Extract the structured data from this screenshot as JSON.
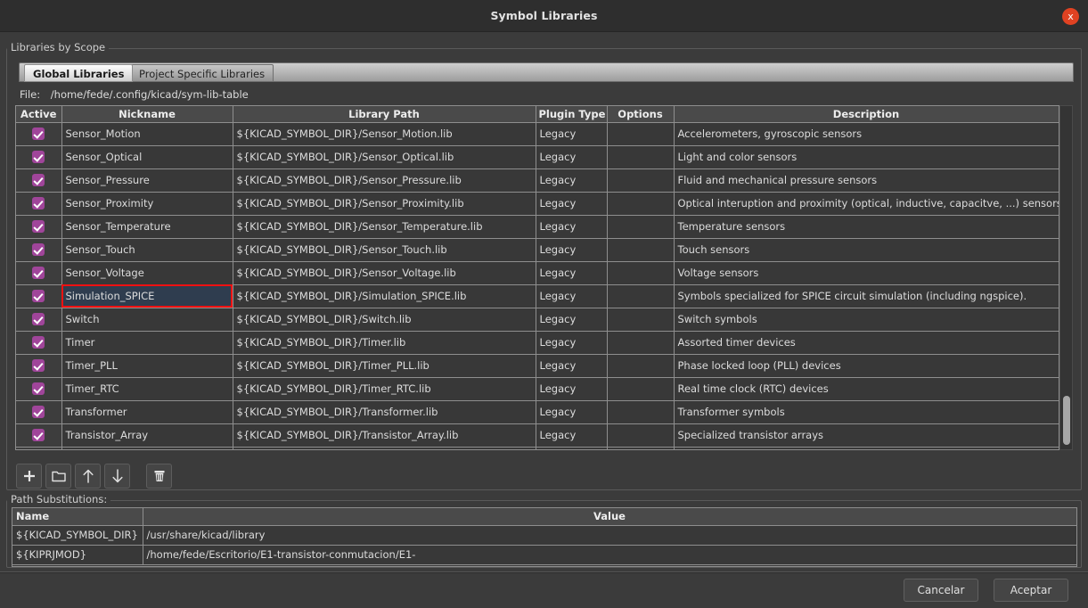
{
  "window": {
    "title": "Symbol Libraries",
    "close_icon": "close-icon",
    "close_label": "x"
  },
  "scope_group": {
    "label": "Libraries by Scope"
  },
  "tabs": [
    {
      "label": "Global Libraries",
      "active": true
    },
    {
      "label": "Project Specific Libraries",
      "active": false
    }
  ],
  "file": {
    "label": "File:",
    "value": "/home/fede/.config/kicad/sym-lib-table"
  },
  "grid": {
    "columns": [
      "Active",
      "Nickname",
      "Library Path",
      "Plugin Type",
      "Options",
      "Description"
    ],
    "selected_row_index": 7,
    "selected_column": "Nickname",
    "rows": [
      {
        "active": true,
        "nickname": "Sensor_Motion",
        "path": "${KICAD_SYMBOL_DIR}/Sensor_Motion.lib",
        "plugin": "Legacy",
        "options": "",
        "description": "Accelerometers, gyroscopic sensors"
      },
      {
        "active": true,
        "nickname": "Sensor_Optical",
        "path": "${KICAD_SYMBOL_DIR}/Sensor_Optical.lib",
        "plugin": "Legacy",
        "options": "",
        "description": "Light and color sensors"
      },
      {
        "active": true,
        "nickname": "Sensor_Pressure",
        "path": "${KICAD_SYMBOL_DIR}/Sensor_Pressure.lib",
        "plugin": "Legacy",
        "options": "",
        "description": "Fluid and mechanical pressure sensors"
      },
      {
        "active": true,
        "nickname": "Sensor_Proximity",
        "path": "${KICAD_SYMBOL_DIR}/Sensor_Proximity.lib",
        "plugin": "Legacy",
        "options": "",
        "description": "Optical interuption and proximity (optical, inductive, capacitve, ...) sensors"
      },
      {
        "active": true,
        "nickname": "Sensor_Temperature",
        "path": "${KICAD_SYMBOL_DIR}/Sensor_Temperature.lib",
        "plugin": "Legacy",
        "options": "",
        "description": "Temperature sensors"
      },
      {
        "active": true,
        "nickname": "Sensor_Touch",
        "path": "${KICAD_SYMBOL_DIR}/Sensor_Touch.lib",
        "plugin": "Legacy",
        "options": "",
        "description": "Touch sensors"
      },
      {
        "active": true,
        "nickname": "Sensor_Voltage",
        "path": "${KICAD_SYMBOL_DIR}/Sensor_Voltage.lib",
        "plugin": "Legacy",
        "options": "",
        "description": "Voltage sensors"
      },
      {
        "active": true,
        "nickname": "Simulation_SPICE",
        "path": "${KICAD_SYMBOL_DIR}/Simulation_SPICE.lib",
        "plugin": "Legacy",
        "options": "",
        "description": "Symbols specialized for SPICE circuit simulation (including ngspice)."
      },
      {
        "active": true,
        "nickname": "Switch",
        "path": "${KICAD_SYMBOL_DIR}/Switch.lib",
        "plugin": "Legacy",
        "options": "",
        "description": "Switch symbols"
      },
      {
        "active": true,
        "nickname": "Timer",
        "path": "${KICAD_SYMBOL_DIR}/Timer.lib",
        "plugin": "Legacy",
        "options": "",
        "description": "Assorted timer devices"
      },
      {
        "active": true,
        "nickname": "Timer_PLL",
        "path": "${KICAD_SYMBOL_DIR}/Timer_PLL.lib",
        "plugin": "Legacy",
        "options": "",
        "description": "Phase locked loop (PLL) devices"
      },
      {
        "active": true,
        "nickname": "Timer_RTC",
        "path": "${KICAD_SYMBOL_DIR}/Timer_RTC.lib",
        "plugin": "Legacy",
        "options": "",
        "description": "Real time clock (RTC) devices"
      },
      {
        "active": true,
        "nickname": "Transformer",
        "path": "${KICAD_SYMBOL_DIR}/Transformer.lib",
        "plugin": "Legacy",
        "options": "",
        "description": "Transformer symbols"
      },
      {
        "active": true,
        "nickname": "Transistor_Array",
        "path": "${KICAD_SYMBOL_DIR}/Transistor_Array.lib",
        "plugin": "Legacy",
        "options": "",
        "description": "Specialized transistor arrays"
      }
    ]
  },
  "toolbar": {
    "buttons": [
      {
        "name": "add-library-button",
        "icon": "plus-icon"
      },
      {
        "name": "browse-library-button",
        "icon": "folder-icon"
      },
      {
        "name": "move-up-button",
        "icon": "arrow-up-icon"
      },
      {
        "name": "move-down-button",
        "icon": "arrow-down-icon"
      },
      {
        "name": "delete-library-button",
        "icon": "trash-icon"
      }
    ]
  },
  "path_substitutions": {
    "label": "Path Substitutions:",
    "columns": [
      "Name",
      "Value"
    ],
    "rows": [
      {
        "name": "${KICAD_SYMBOL_DIR}",
        "value": "/usr/share/kicad/library"
      },
      {
        "name": "${KIPRJMOD}",
        "value": "/home/fede/Escritorio/E1-transistor-conmutacion/E1-"
      }
    ]
  },
  "footer": {
    "cancel_label": "Cancelar",
    "ok_label": "Aceptar"
  },
  "colors": {
    "dialog_bg": "#3b3b3b",
    "titlebar_bg": "#2e2e2e",
    "grid_bg": "#383838",
    "header_bg": "#4a4a4a",
    "checkbox": "#a0459a",
    "selection_bg": "#2f3d4f",
    "highlight_border": "#ee1111",
    "close_button": "#e04222"
  }
}
